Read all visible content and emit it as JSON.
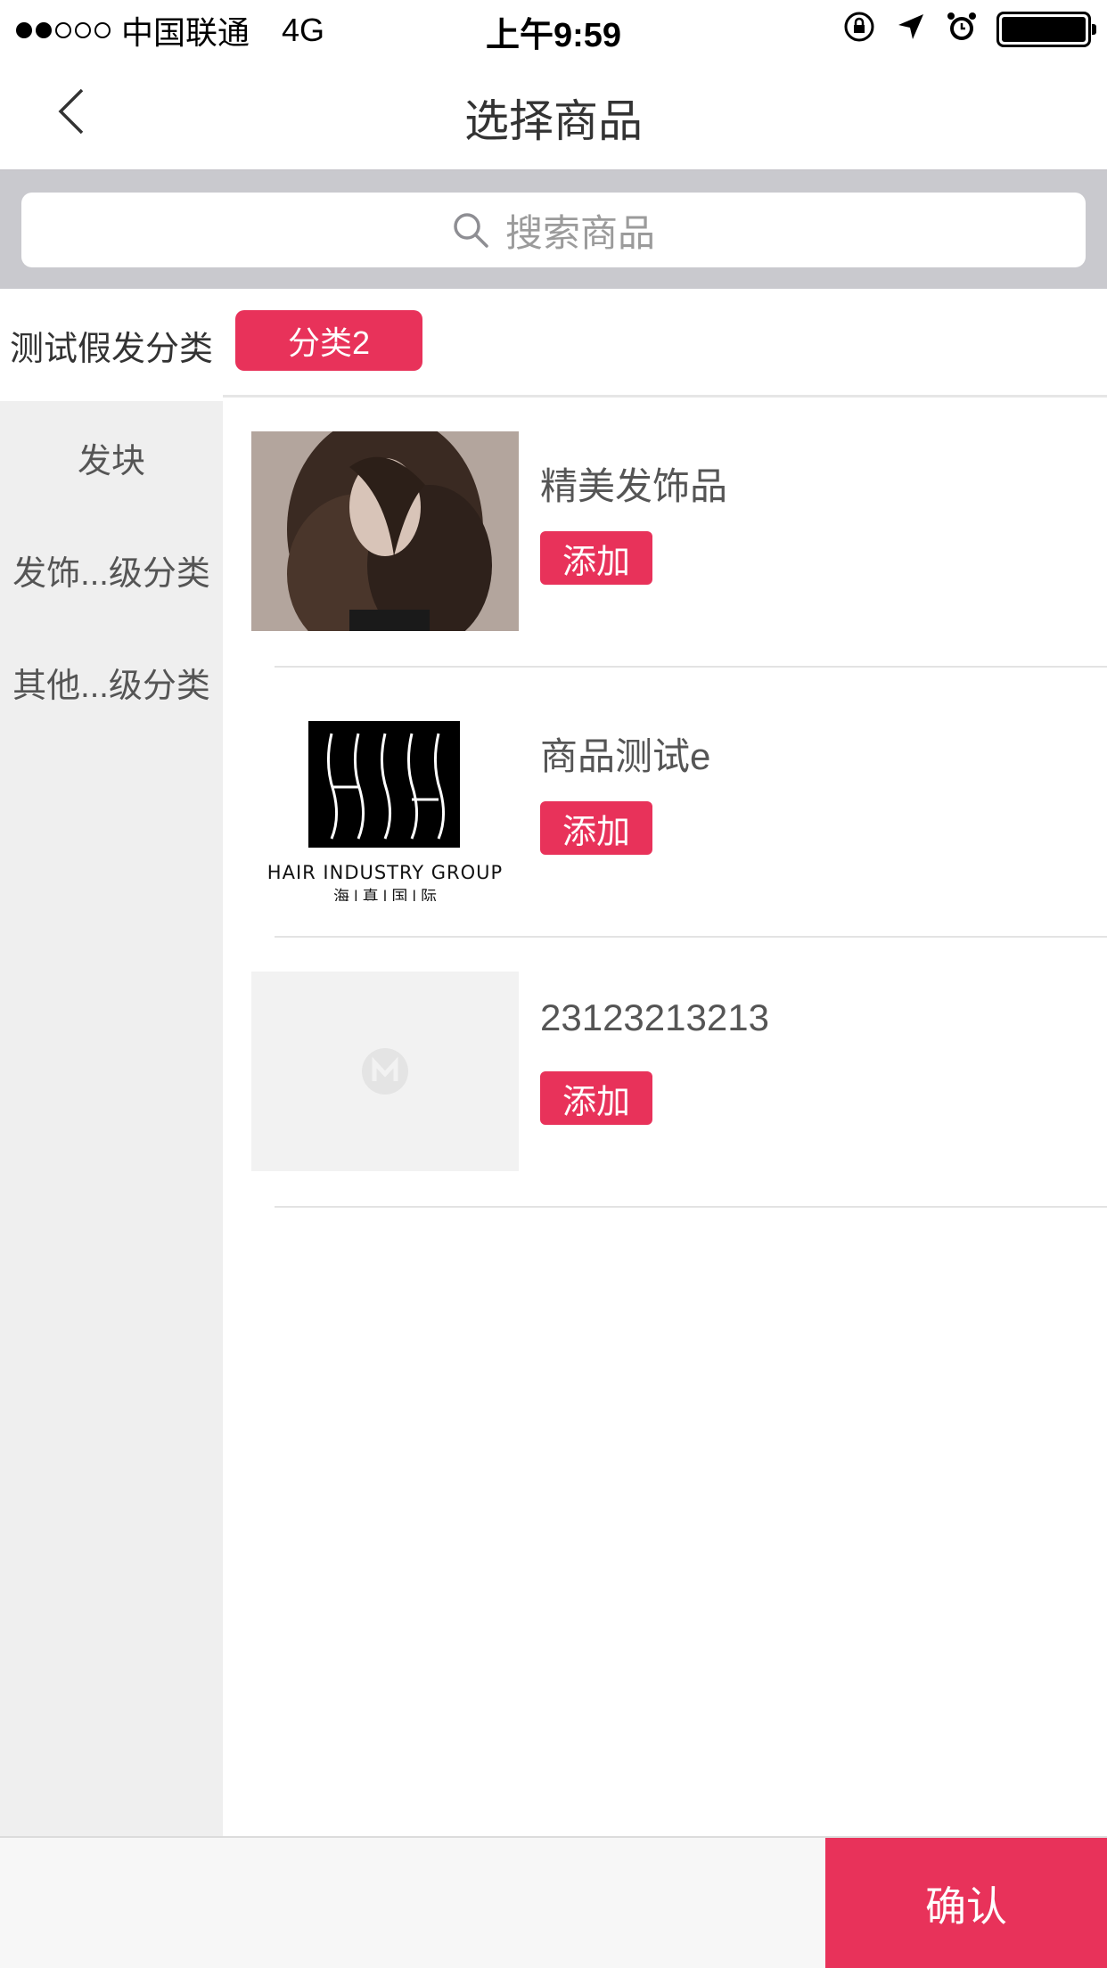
{
  "status_bar": {
    "carrier": "中国联通",
    "network": "4G",
    "time": "上午9:59",
    "signal_strength": 2,
    "icons": [
      "orientation-lock-icon",
      "location-arrow-icon",
      "alarm-icon",
      "battery-icon"
    ]
  },
  "nav": {
    "title": "选择商品",
    "back_icon": "chevron-left-icon"
  },
  "search": {
    "placeholder": "搜索商品",
    "icon": "search-icon"
  },
  "categories": {
    "top_category": "测试假发分类",
    "items": [
      {
        "label": "发块"
      },
      {
        "label": "发饰...级分类"
      },
      {
        "label": "其他...级分类"
      }
    ]
  },
  "subcategory": {
    "selected": "分类2"
  },
  "products": [
    {
      "name": "精美发饰品",
      "add_label": "添加",
      "image": "hair-model-photo"
    },
    {
      "name": "商品测试e",
      "add_label": "添加",
      "image": "hair-industry-group-logo",
      "logo_text": "HAIR INDUSTRY GROUP",
      "logo_subtext": "海 | 真 | 国 | 际"
    },
    {
      "name": "23123213213",
      "add_label": "添加",
      "image": "placeholder-image"
    }
  ],
  "footer": {
    "confirm_label": "确认"
  },
  "colors": {
    "accent": "#e8325a",
    "search_bg": "#c9c9ce",
    "sidebar_bg": "#efefef"
  }
}
